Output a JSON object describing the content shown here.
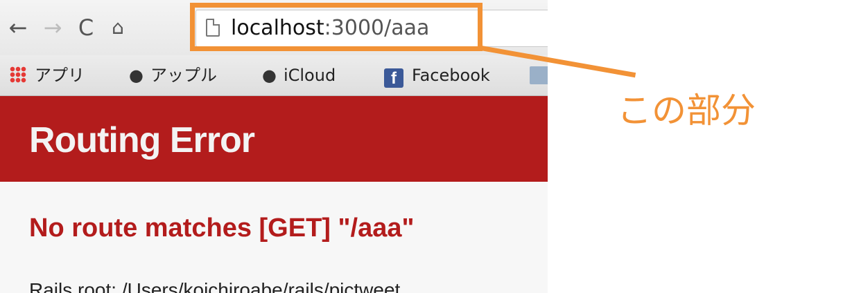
{
  "browser": {
    "nav": {
      "back_glyph": "←",
      "forward_glyph": "→",
      "reload_glyph": "C",
      "home_glyph": "⌂"
    },
    "omnibox": {
      "url_host": "localhost",
      "url_rest": ":3000/aaa",
      "page_icon": "page-icon"
    },
    "bookmarks": [
      {
        "label": "アプリ",
        "icon": "apps-grid-icon"
      },
      {
        "label": "アップル",
        "icon": "apple-icon"
      },
      {
        "label": "iCloud",
        "icon": "apple-icon"
      },
      {
        "label": "Facebook",
        "icon": "facebook-icon"
      }
    ],
    "colors": {
      "header_red": "#b31c1c",
      "annotation_orange": "#f29236"
    }
  },
  "page": {
    "title": "Routing Error",
    "error_heading": "No route matches [GET] \"/aaa\"",
    "rails_root": "Rails root: /Users/koichiroabe/rails/pictweet"
  },
  "annotation": {
    "label": "この部分"
  }
}
